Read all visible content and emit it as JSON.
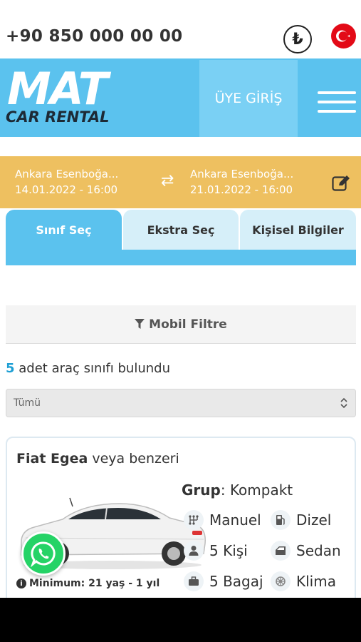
{
  "topbar": {
    "phone": "+90 850 000 00 00",
    "currency_icon": "turkish-lira-icon",
    "language_flag": "turkey-flag"
  },
  "header": {
    "logo_main": "MAT",
    "logo_sub": "CAR RENTAL",
    "login_label": "ÜYE GİRİŞ",
    "menu_icon": "hamburger-icon",
    "accent_color": "#5bc2ee"
  },
  "booking": {
    "pickup_location": "Ankara Esenboğa...",
    "pickup_datetime": "14.01.2022 - 16:00",
    "dropoff_location": "Ankara Esenboğa...",
    "dropoff_datetime": "21.01.2022 - 16:00",
    "swap_icon": "swap-arrows-icon",
    "edit_icon": "edit-icon",
    "color": "#eec060"
  },
  "tabs": [
    {
      "label": "Sınıf Seç",
      "active": true
    },
    {
      "label": "Ekstra Seç",
      "active": false
    },
    {
      "label": "Kişisel Bilgiler",
      "active": false
    }
  ],
  "filter": {
    "label": "Mobil Filtre",
    "icon": "filter-icon"
  },
  "results": {
    "count": "5",
    "text": "adet araç sınıfı bulundu"
  },
  "class_select": {
    "selected": "Tümü"
  },
  "car": {
    "name": "Fiat Egea",
    "suffix": "veya benzeri",
    "group_label": "Grup",
    "group_value": ": Kompakt",
    "features": {
      "transmission": "Manuel",
      "fuel": "Dizel",
      "persons": "5 Kişi",
      "body": "Sedan",
      "bags": "5 Bagaj",
      "ac": "Klima"
    },
    "minimum": "Minimum: 21 yaş - 1 yıl"
  },
  "whatsapp_icon": "whatsapp-icon"
}
